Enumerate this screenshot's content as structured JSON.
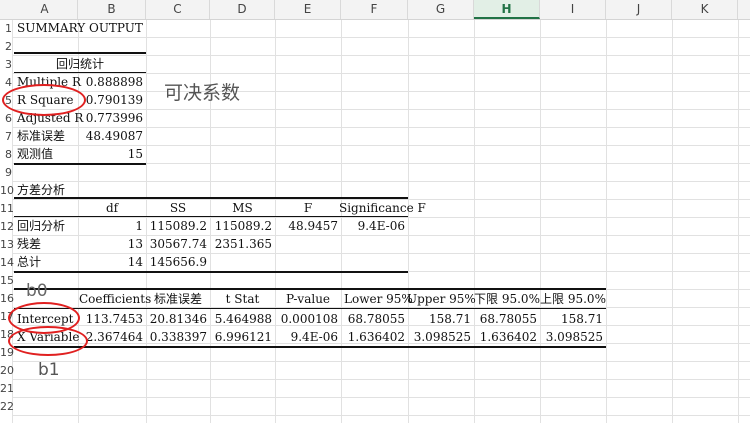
{
  "columns": [
    "A",
    "B",
    "C",
    "D",
    "E",
    "F",
    "G",
    "H",
    "I",
    "J",
    "K"
  ],
  "selected_column": "H",
  "rows": [
    "1",
    "2",
    "3",
    "4",
    "5",
    "6",
    "7",
    "8",
    "9",
    "10",
    "11",
    "12",
    "13",
    "14",
    "15",
    "16",
    "17",
    "18",
    "19",
    "20",
    "21",
    "22"
  ],
  "summary": {
    "title": "SUMMARY OUTPUT",
    "stats_header": "回归统计",
    "stats": [
      {
        "label": "Multiple R",
        "value": "0.888898"
      },
      {
        "label": "R Square",
        "value": "0.790139"
      },
      {
        "label": "Adjusted R",
        "value": "0.773996"
      },
      {
        "label": "标准误差",
        "value": "48.49087"
      },
      {
        "label": "观测值",
        "value": "15"
      }
    ]
  },
  "anova": {
    "title": "方差分析",
    "headers": [
      "",
      "df",
      "SS",
      "MS",
      "F",
      "Significance F"
    ],
    "rows": [
      [
        "回归分析",
        "1",
        "115089.2",
        "115089.2",
        "48.9457",
        "9.4E-06"
      ],
      [
        "残差",
        "13",
        "30567.74",
        "2351.365",
        "",
        ""
      ],
      [
        "总计",
        "14",
        "145656.9",
        "",
        "",
        ""
      ]
    ]
  },
  "coef": {
    "headers": [
      "",
      "Coefficients",
      "标准误差",
      "t Stat",
      "P-value",
      "Lower 95%",
      "Upper 95%",
      "下限 95.0%",
      "上限 95.0%"
    ],
    "rows": [
      [
        "Intercept",
        "113.7453",
        "20.81346",
        "5.464988",
        "0.000108",
        "68.78055",
        "158.71",
        "68.78055",
        "158.71"
      ],
      [
        "X Variable",
        "2.367464",
        "0.338397",
        "6.996121",
        "9.4E-06",
        "1.636402",
        "3.098525",
        "1.636402",
        "3.098525"
      ]
    ]
  },
  "annotations": {
    "r2_note": "可决系数",
    "b0": "b0",
    "b1": "b1",
    "circle_color": "#e02020"
  }
}
